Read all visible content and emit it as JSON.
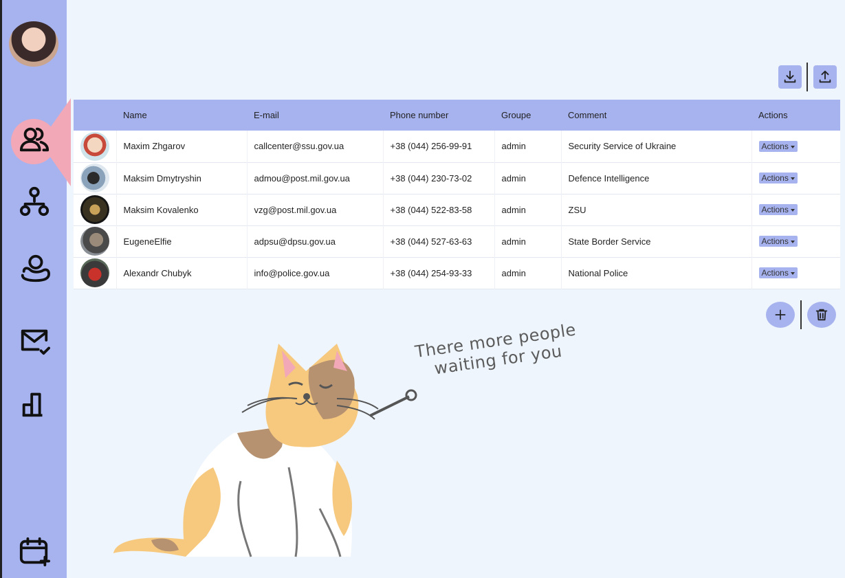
{
  "sidebar": {
    "items": [
      {
        "name": "users-icon"
      },
      {
        "name": "hierarchy-icon"
      },
      {
        "name": "profile-card-icon"
      },
      {
        "name": "mail-check-icon"
      },
      {
        "name": "chart-icon"
      },
      {
        "name": "calendar-add-icon"
      }
    ],
    "active": "users-icon"
  },
  "toolbar": {
    "download_icon": "download-icon",
    "upload_icon": "upload-icon"
  },
  "table": {
    "headers": [
      "",
      "Name",
      "E-mail",
      "Phone number",
      "Groupe",
      "Comment",
      "Actions"
    ],
    "rows": [
      {
        "name": "Maxim Zhgarov",
        "email": "callcenter@ssu.gov.ua",
        "phone": "+38 (044) 256-99-91",
        "group": "admin",
        "comment": "Security Service of Ukraine",
        "action": "Actions"
      },
      {
        "name": "Maksim Dmytryshin",
        "email": "admou@post.mil.gov.ua",
        "phone": "+38 (044) 230-73-02",
        "group": "admin",
        "comment": "Defence Intelligence",
        "action": "Actions"
      },
      {
        "name": "Maksim Kovalenko",
        "email": "vzg@post.mil.gov.ua",
        "phone": "+38 (044) 522-83-58",
        "group": "admin",
        "comment": "ZSU",
        "action": "Actions"
      },
      {
        "name": "EugeneElfie",
        "email": "adpsu@dpsu.gov.ua",
        "phone": "+38 (044) 527-63-63",
        "group": "admin",
        "comment": "State Border Service",
        "action": "Actions"
      },
      {
        "name": "Alexandr Chubyk",
        "email": "info@police.gov.ua",
        "phone": "+38 (044) 254-93-33",
        "group": "admin",
        "comment": "National Police",
        "action": "Actions"
      }
    ]
  },
  "illustration": {
    "line1": "There more people",
    "line2": "waiting for you"
  },
  "colors": {
    "accent": "#a7b3ef",
    "active": "#f2a8b6",
    "background": "#eef5fd"
  }
}
